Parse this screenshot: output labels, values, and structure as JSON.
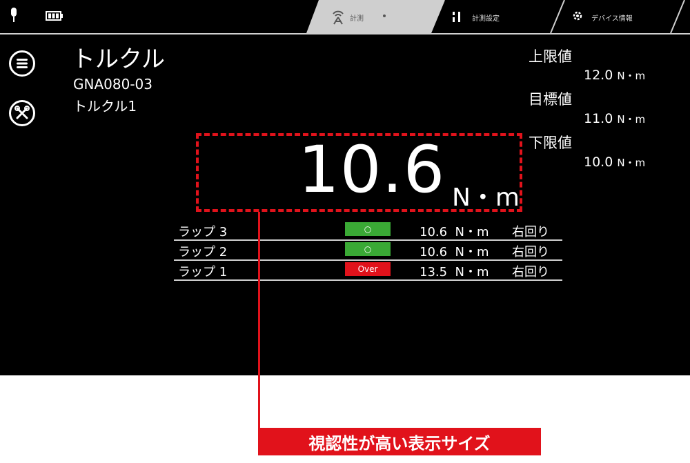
{
  "tabs": [
    {
      "label": "計測",
      "active": true
    },
    {
      "label": "計測設定",
      "active": false
    },
    {
      "label": "デバイス情報",
      "active": false
    }
  ],
  "device": {
    "title": "トルクル",
    "model": "GNA080-03",
    "tool_name": "トルクル1"
  },
  "limits": {
    "upper": {
      "label": "上限値",
      "value": "12.0",
      "unit": "N・m"
    },
    "target": {
      "label": "目標値",
      "value": "11.0",
      "unit": "N・m"
    },
    "lower": {
      "label": "下限値",
      "value": "10.0",
      "unit": "N・m"
    }
  },
  "reading": {
    "value": "10.6",
    "unit": "N・m"
  },
  "laps": [
    {
      "label": "ラップ 3",
      "status": "○",
      "status_color": "#3aa935",
      "value": "10.6",
      "unit": "N・m",
      "direction": "右回り"
    },
    {
      "label": "ラップ 2",
      "status": "○",
      "status_color": "#3aa935",
      "value": "10.6",
      "unit": "N・m",
      "direction": "右回り"
    },
    {
      "label": "ラップ 1",
      "status": "Over",
      "status_color": "#e1121b",
      "value": "13.5",
      "unit": "N・m",
      "direction": "右回り"
    }
  ],
  "callout": {
    "text": "視認性が高い表示サイズ"
  },
  "colors": {
    "accent": "#e1121b",
    "ok": "#3aa935",
    "active_tab": "#cfcfcf"
  }
}
